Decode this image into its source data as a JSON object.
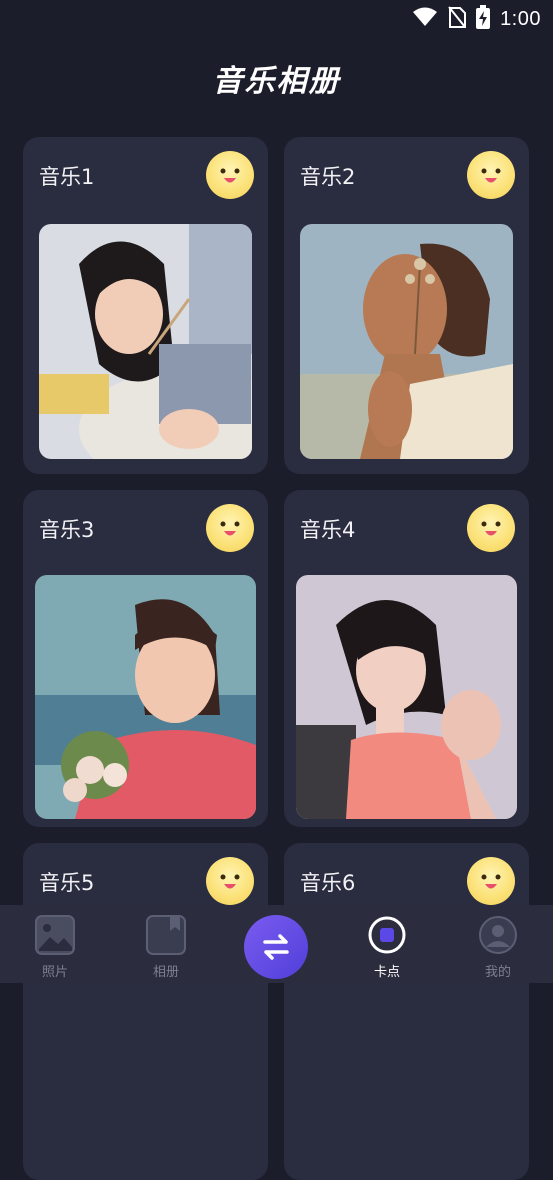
{
  "status_bar": {
    "time": "1:00",
    "icons": [
      "wifi-icon",
      "no-sim-icon",
      "battery-charging-icon"
    ]
  },
  "header": {
    "title": "音乐相册"
  },
  "albums": [
    {
      "label": "音乐1",
      "photo": "girl-holding-paintbrush-photo"
    },
    {
      "label": "音乐2",
      "photo": "woman-with-dried-flowers-photo"
    },
    {
      "label": "音乐3",
      "photo": "girl-with-flower-bouquet-photo"
    },
    {
      "label": "音乐4",
      "photo": "woman-pink-top-photo"
    },
    {
      "label": "音乐5",
      "photo": ""
    },
    {
      "label": "音乐6",
      "photo": ""
    }
  ],
  "bottom_nav": {
    "items": [
      {
        "label": "照片",
        "icon": "photo-icon",
        "active": false
      },
      {
        "label": "相册",
        "icon": "album-icon",
        "active": false
      },
      {
        "label": "",
        "icon": "swap-arrows-icon",
        "active": false
      },
      {
        "label": "卡点",
        "icon": "record-icon",
        "active": true
      },
      {
        "label": "我的",
        "icon": "profile-icon",
        "active": false
      }
    ]
  },
  "colors": {
    "background": "#1c1d2b",
    "card": "#2a2c40",
    "nav_background": "#2b2d3f",
    "accent": "#5b48e6",
    "face": "#fbe27a"
  }
}
